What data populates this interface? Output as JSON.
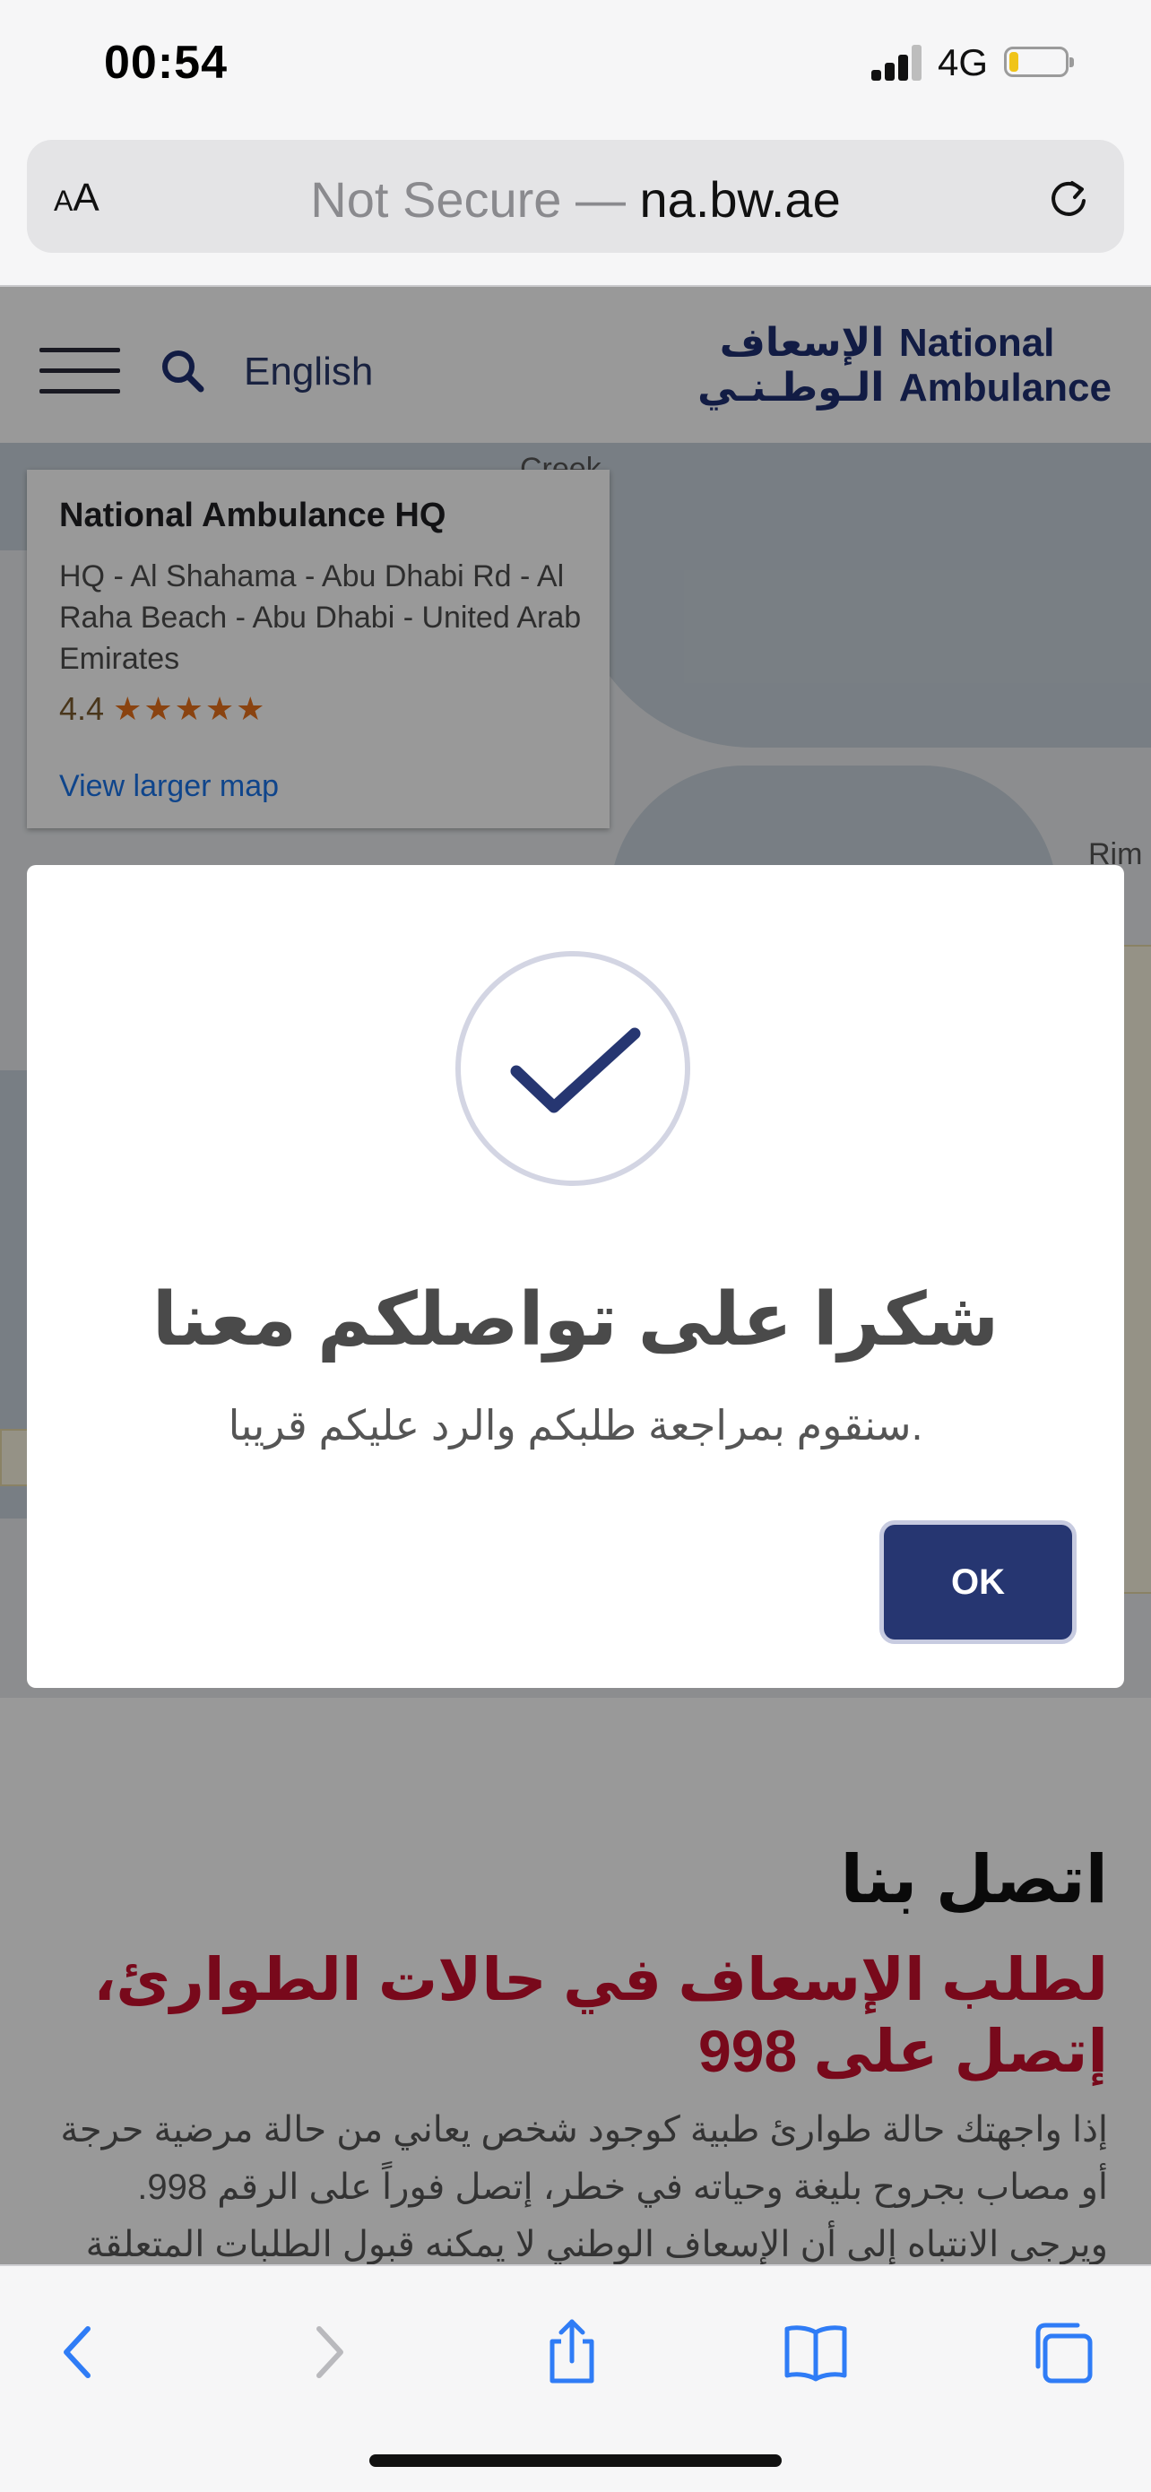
{
  "status_bar": {
    "time": "00:54",
    "network": "4G"
  },
  "safari": {
    "aa_small": "A",
    "aa_large": "A",
    "url_prefix": "Not Secure — ",
    "url_domain": "na.bw.ae"
  },
  "header": {
    "language_link": "English",
    "logo_ar_line1": "الإسعاف",
    "logo_ar_line2": "الـوطـنـي",
    "logo_en_line1": "National",
    "logo_en_line2": "Ambulance"
  },
  "map": {
    "place_title": "National Ambulance HQ",
    "address": "HQ - Al Shahama - Abu Dhabi Rd - Al Raha Beach - Abu Dhabi - United Arab Emirates",
    "rating": "4.4",
    "stars": "★★★★★",
    "view_larger": "View larger map",
    "label_creek": "Creek",
    "label_rim": "Rim"
  },
  "modal": {
    "title": "شكرا على تواصلكم معنا",
    "message": ".سنقوم بمراجعة طلبكم والرد عليكم قريبا",
    "ok_label": "OK"
  },
  "content": {
    "heading": "اتصل بنا",
    "emergency": "لطلب الإسعاف في حالات الطوارئ، إتصل على 998",
    "paragraph": "إذا واجهتك حالة طوارئ طبية كوجود شخص يعاني من حالة مرضية حرجة أو مصاب بجروح بليغة وحياته في خطر، إتصل فوراً على الرقم 998. ويرجى الانتباه إلى أن الإسعاف الوطني لا يمكنه قبول الطلبات المتعلقة بالطوارئ عبر الموقع الإلكتروني. وتوضح هذه الصفحة الطرق المختلفة للتواصل مع"
  },
  "colors": {
    "brand_navy": "#263671",
    "emergency_red": "#c8102e"
  }
}
